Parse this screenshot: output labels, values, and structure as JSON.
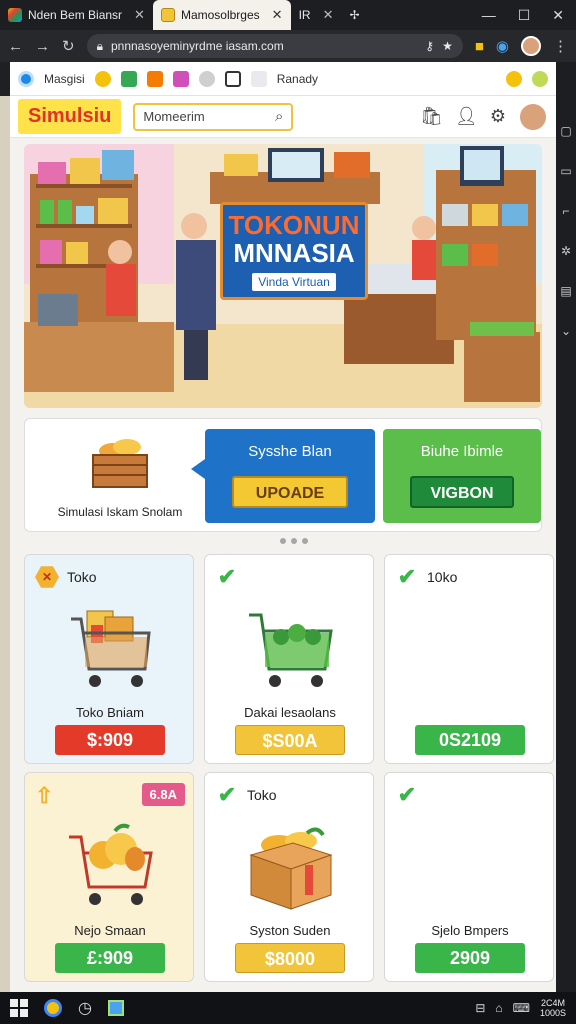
{
  "browser": {
    "tabs": [
      {
        "title": "Nden Bem Biansr"
      },
      {
        "title": "Mamosolbrges"
      },
      {
        "title": "IR"
      }
    ],
    "url": "pnnnasoyeminyrdme iasam.com"
  },
  "bookmarks": {
    "items": [
      {
        "label": "Masgisi"
      },
      {
        "label": "Ranady"
      }
    ]
  },
  "site": {
    "logo": "Simulsiu",
    "search_placeholder": "Momeerim"
  },
  "hero": {
    "title_line1": "TOKONUN",
    "title_line2": "MNNASIA",
    "subtitle": "Vinda Virtuan"
  },
  "promo": {
    "left_label": "Simulasi Iskam Snolam",
    "blue_title": "Sysshe Blan",
    "blue_button": "UPOADE",
    "green_title": "Biuhe Ibimle",
    "green_button": "VIGBON"
  },
  "cards": [
    {
      "header": "Toko",
      "name": "Toko Bniam",
      "price": "$:909"
    },
    {
      "header": "",
      "name": "Dakai lesaolans",
      "price": "$S00A"
    },
    {
      "header": "10ko",
      "name": "",
      "price": "0S2109"
    },
    {
      "header": "",
      "pill": "6.8A",
      "name": "Nejo Smaan",
      "price": "£:909"
    },
    {
      "header": "Toko",
      "name": "Syston Suden",
      "price": "$8000"
    },
    {
      "header": "",
      "name": "Sjelo Bmpers",
      "price": "2909"
    }
  ],
  "taskbar": {
    "clock_time": "2C4M",
    "clock_date": "1000S"
  },
  "colors": {
    "accent_yellow": "#ffe24a",
    "logo_red": "#e0332a",
    "promo_blue": "#1e73c8",
    "promo_green": "#5cbe4a",
    "price_red": "#e43a2a",
    "price_yellow": "#f1c43a",
    "price_green": "#3ab54a"
  }
}
